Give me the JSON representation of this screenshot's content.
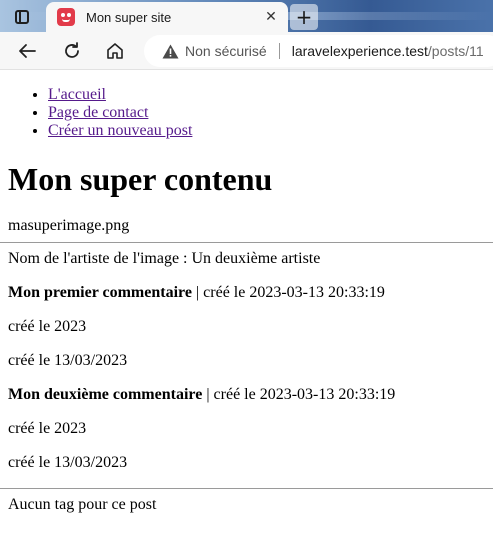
{
  "browser": {
    "tab_title": "Mon super site",
    "security_label": "Non sécurisé",
    "url_host": "laravelexperience.test",
    "url_path": "/posts/11"
  },
  "nav": {
    "items": [
      {
        "label": "L'accueil"
      },
      {
        "label": "Page de contact"
      },
      {
        "label": "Créer un nouveau post"
      }
    ]
  },
  "content": {
    "heading": "Mon super contenu",
    "image_name": "masuperimage.png",
    "artist_line": "Nom de l'artiste de l'image : Un deuxième artiste",
    "comments": [
      {
        "title": "Mon premier commentaire",
        "created": " | créé le 2023-03-13 20:33:19",
        "year_line": "créé le 2023",
        "date_line": "créé le 13/03/2023"
      },
      {
        "title": "Mon deuxième commentaire",
        "created": " | créé le 2023-03-13 20:33:19",
        "year_line": "créé le 2023",
        "date_line": "créé le 13/03/2023"
      }
    ],
    "no_tags": "Aucun tag pour ce post"
  }
}
